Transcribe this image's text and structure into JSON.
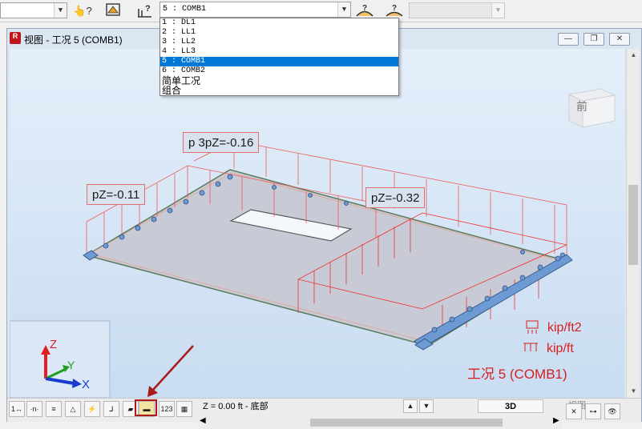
{
  "top_toolbar": {
    "left_combo_value": "",
    "load_case_combo_value": "5 : COMB1",
    "right_combo_value": "",
    "buttons": [
      "help-pointer-icon",
      "view-frame-icon",
      "load-query-icon",
      "load-display-icon",
      "load-edit-icon"
    ]
  },
  "load_case_dropdown": {
    "items": [
      {
        "label": "1 : DL1",
        "selected": false
      },
      {
        "label": "2 : LL1",
        "selected": false
      },
      {
        "label": "3 : LL2",
        "selected": false
      },
      {
        "label": "4 : LL3",
        "selected": false
      },
      {
        "label": "5 : COMB1",
        "selected": true
      },
      {
        "label": "6 : COMB2",
        "selected": false
      },
      {
        "label": "简单工况",
        "selected": false
      },
      {
        "label": "组合",
        "selected": false
      }
    ]
  },
  "window": {
    "title": "视图 - 工况 5 (COMB1)",
    "minimize": "—",
    "restore": "❐",
    "close": "✕"
  },
  "viewport": {
    "view_cube_label": "前",
    "load_labels": {
      "left": "pZ=-0.11",
      "top": "p 3pZ=-0.16",
      "right": "pZ=-0.32"
    },
    "axes": {
      "z": "Z",
      "y": "Y",
      "x": "X"
    },
    "units_area": "kip/ft2",
    "units_line": "kip/ft",
    "case_label": "工况 5 (COMB1)",
    "colors": {
      "load": "#e44040",
      "slab": "#c9ccd6",
      "support": "#6e9ad4",
      "units": "#d62020"
    }
  },
  "status_bar": {
    "level": "Z = 0.00 ft - 底部",
    "tab_3d": "3D",
    "tab_view": "视图",
    "mini_buttons": [
      "node-label-icon",
      "member-label-icon",
      "panel-label-icon",
      "support-icon",
      "release-icon",
      "axis-icon",
      "slab-fill-icon",
      "slab-outline-icon",
      "numbering-icon",
      "grid-icon"
    ]
  }
}
